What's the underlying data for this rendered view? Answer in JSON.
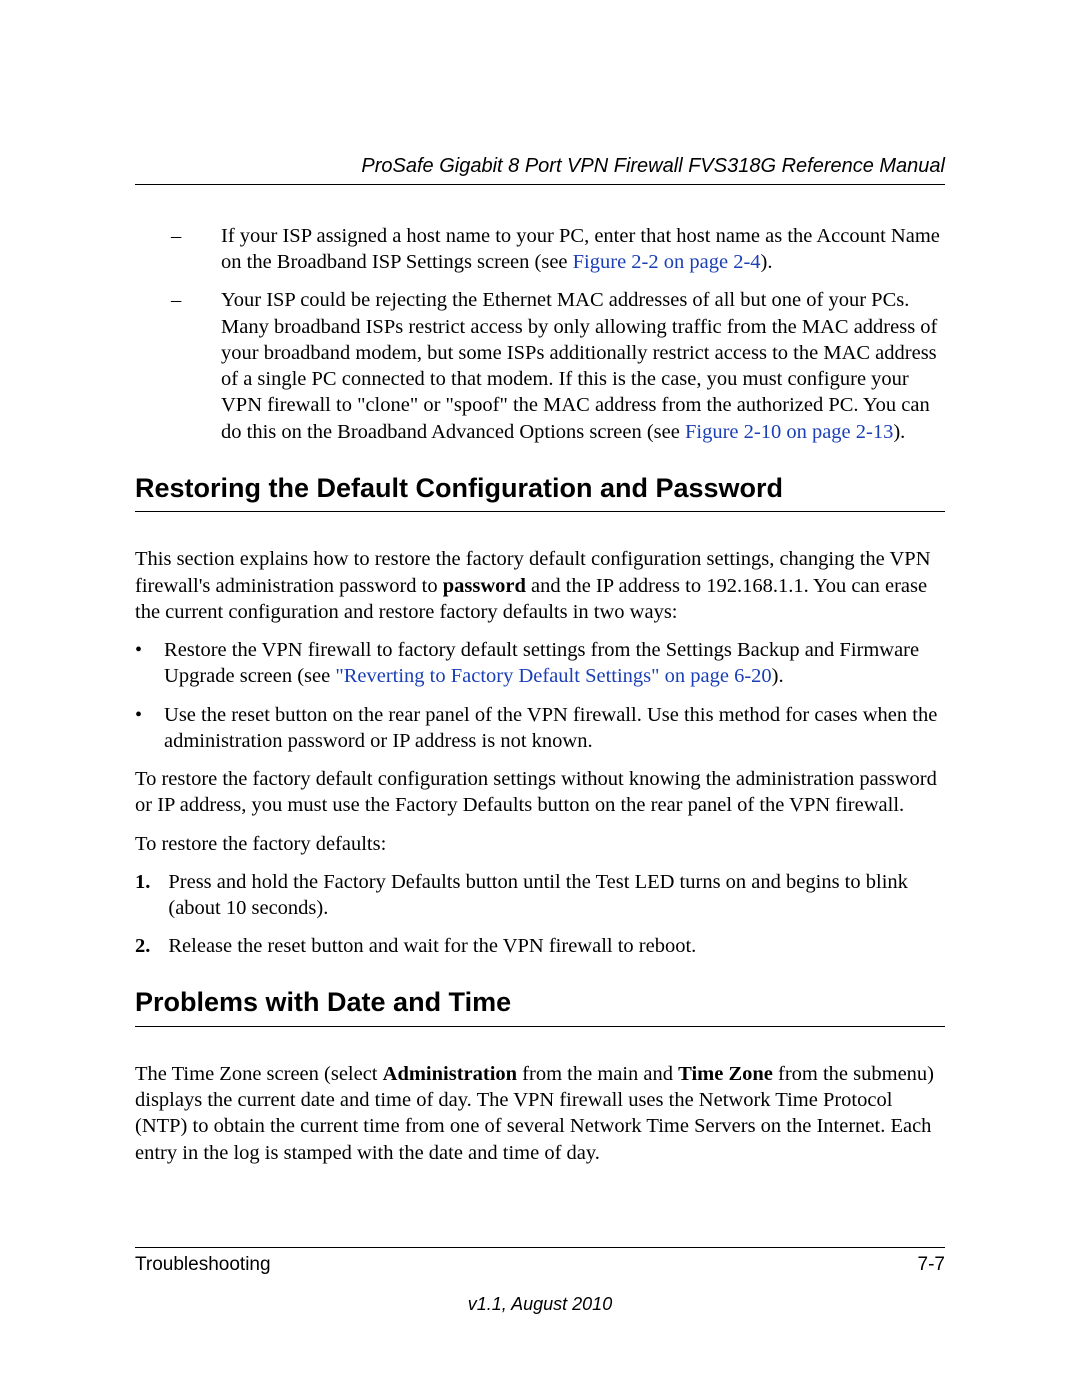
{
  "header": {
    "title": "ProSafe Gigabit 8 Port VPN Firewall FVS318G Reference Manual"
  },
  "body": {
    "dash1_a": "If your ISP assigned a host name to your PC, enter that host name as the Account Name on the Broadband ISP Settings screen (see ",
    "dash1_link": "Figure 2-2 on page 2-4",
    "dash1_b": ").",
    "dash2_a": "Your ISP could be rejecting the Ethernet MAC addresses of all but one of your PCs. Many broadband ISPs restrict access by only allowing traffic from the MAC address of your broadband modem, but some ISPs additionally restrict access to the MAC address of a single PC connected to that modem. If this is the case, you must configure your VPN firewall to \"clone\" or \"spoof\" the MAC address from the authorized PC. You can do this on the Broadband Advanced Options screen (see ",
    "dash2_link": "Figure 2-10 on page 2-13",
    "dash2_b": ").",
    "h1": "Restoring the Default Configuration and Password",
    "p1_a": "This section explains how to restore the factory default configuration settings, changing the VPN firewall's administration password to ",
    "p1_bold": "password",
    "p1_b": " and the IP address to 192.168.1.1. You can erase the current configuration and restore factory defaults in two ways:",
    "b1_a": "Restore the VPN firewall to factory default settings from the Settings Backup and Firmware Upgrade screen (see ",
    "b1_link": "\"Reverting to Factory Default Settings\" on page 6-20",
    "b1_b": ").",
    "b2": "Use the reset button on the rear panel of the VPN firewall. Use this method for cases when the administration password or IP address is not known.",
    "p2": "To restore the factory default configuration settings without knowing the administration password or IP address, you must use the Factory Defaults button on the rear panel of the VPN firewall.",
    "p3": "To restore the factory defaults:",
    "n1": "Press and hold the Factory Defaults button until the Test LED turns on and begins to blink (about 10 seconds).",
    "n2": "Release the reset button and wait for the VPN firewall to reboot.",
    "h2": "Problems with Date and Time",
    "p4_a": "The Time Zone screen (select ",
    "p4_bold1": "Administration",
    "p4_b": " from the main and ",
    "p4_bold2": "Time Zone",
    "p4_c": " from the submenu) displays the current date and time of day. The VPN firewall uses the Network Time Protocol (NTP) to obtain the current time from one of several Network Time Servers on the Internet. Each entry in the log is stamped with the date and time of day."
  },
  "footer": {
    "section": "Troubleshooting",
    "page": "7-7",
    "version": "v1.1, August 2010"
  }
}
